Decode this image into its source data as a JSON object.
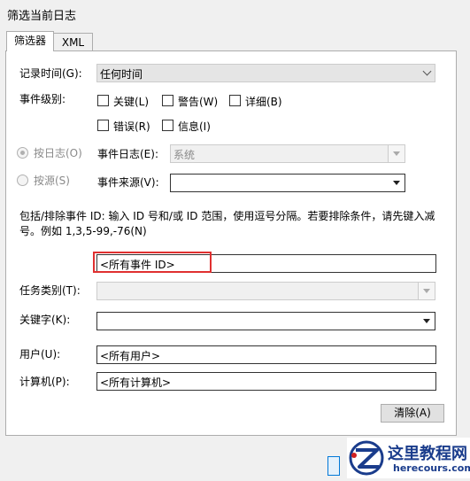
{
  "window": {
    "title": "筛选当前日志"
  },
  "tabs": [
    {
      "label": "筛选器"
    },
    {
      "label": "XML"
    }
  ],
  "logged": {
    "label": "记录时间(G):",
    "value": "任何时间"
  },
  "event_level": {
    "label": "事件级别:",
    "options": [
      "关键(L)",
      "警告(W)",
      "详细(B)",
      "错误(R)",
      "信息(I)"
    ]
  },
  "by_log": {
    "label": "按日志(O)",
    "field_label": "事件日志(E):",
    "value": "系统"
  },
  "by_source": {
    "label": "按源(S)",
    "field_label": "事件来源(V):",
    "value": ""
  },
  "event_id": {
    "description": "包括/排除事件 ID: 输入 ID 号和/或 ID 范围，使用逗号分隔。若要排除条件，请先键入减号。例如 1,3,5-99,-76(N)",
    "value": "<所有事件 ID>"
  },
  "task_category": {
    "label": "任务类别(T):",
    "value": ""
  },
  "keywords": {
    "label": "关键字(K):",
    "value": ""
  },
  "user": {
    "label": "用户(U):",
    "value": "<所有用户>"
  },
  "computer": {
    "label": "计算机(P):",
    "value": "<所有计算机>"
  },
  "clear_button": {
    "label": "清除(A)"
  },
  "watermark": {
    "cn": "这里教程网",
    "url": "herecours.com"
  },
  "colors": {
    "highlight": "#e03030",
    "watermark_blue": "#1a3c8c",
    "watermark_red": "#d02020"
  }
}
